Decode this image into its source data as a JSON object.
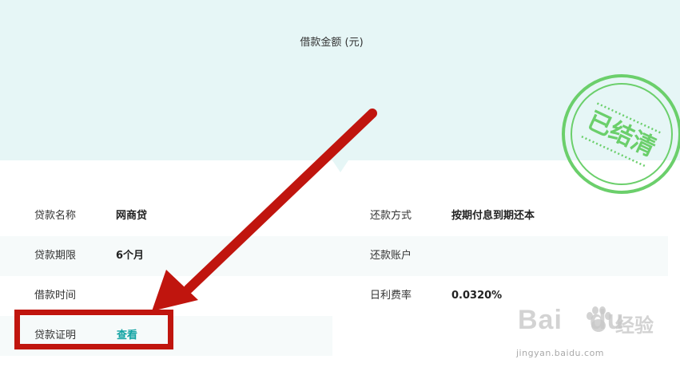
{
  "hero": {
    "title": "借款金额 (元)"
  },
  "stamp": {
    "text": "已结清",
    "color": "#6bcf6b"
  },
  "details": {
    "loan_name": {
      "label": "贷款名称",
      "value": "网商贷"
    },
    "repay_method": {
      "label": "还款方式",
      "value": "按期付息到期还本"
    },
    "loan_term": {
      "label": "贷款期限",
      "value": "6个月"
    },
    "repay_account": {
      "label": "还款账户",
      "value": ""
    },
    "borrow_time": {
      "label": "借款时间",
      "value": ""
    },
    "daily_rate": {
      "label": "日利费率",
      "value": "0.0320%"
    },
    "loan_proof": {
      "label": "贷款证明",
      "link": "查看"
    }
  },
  "watermark": {
    "brand": "Bai",
    "brand_tail": "du",
    "cn": "经验",
    "url": "jingyan.baidu.com"
  },
  "colors": {
    "hero_bg": "#e6f6f6",
    "link": "#12a3a3",
    "annotation_red": "#c0150e",
    "stamp_green": "#6bcf6b"
  }
}
